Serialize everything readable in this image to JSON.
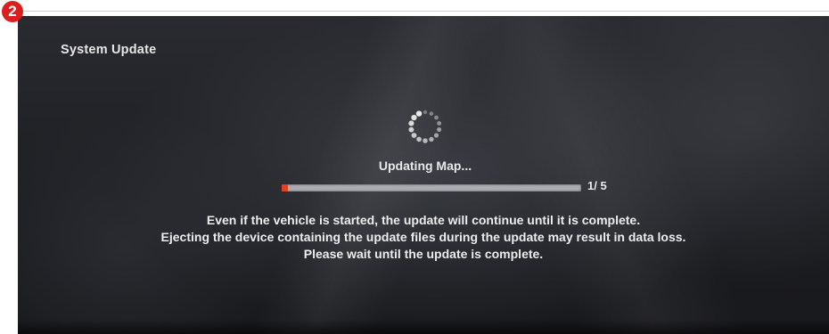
{
  "step_badge": "2",
  "screen": {
    "title": "System Update",
    "status_text": "Updating Map...",
    "progress": {
      "current": 1,
      "total": 5,
      "label": "1/ 5",
      "fill_fraction": 0.02
    },
    "message_lines": [
      "Even if the vehicle is started, the update will continue until it is complete.",
      "Ejecting the device containing the update files during the update may result in data loss.",
      "Please wait until the update is complete."
    ]
  },
  "icons": {
    "spinner": "loading-spinner-icon"
  },
  "colors": {
    "badge": "#d9201e",
    "progress_fill": "#e2401f",
    "progress_track": "#a9acb0",
    "text": "#e8e8e8",
    "background": "#1d1e22"
  }
}
